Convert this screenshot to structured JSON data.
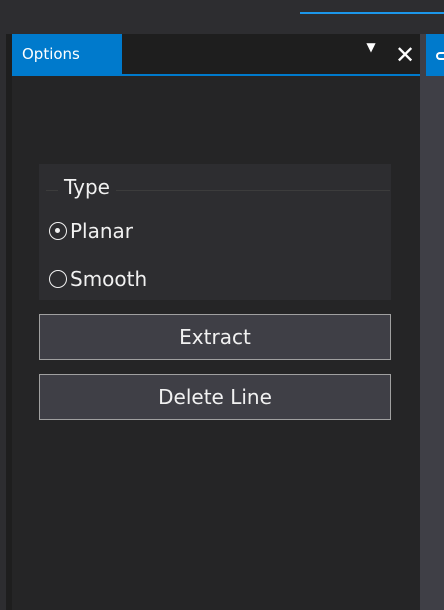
{
  "panel": {
    "tab_label": "Options",
    "dropdown_icon": "▼",
    "close_icon": "✕"
  },
  "type_group": {
    "title": "Type",
    "options": [
      {
        "label": "Planar",
        "selected": true
      },
      {
        "label": "Smooth",
        "selected": false
      }
    ]
  },
  "buttons": {
    "extract": "Extract",
    "delete_line": "Delete Line"
  },
  "colors": {
    "accent": "#007acc",
    "panel_bg": "#252526",
    "text": "#f1f1f1"
  }
}
